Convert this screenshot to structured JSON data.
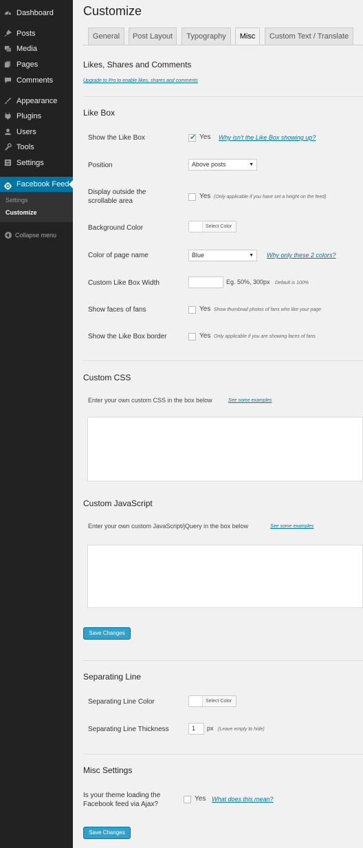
{
  "sidebar": {
    "items": [
      {
        "label": "Dashboard",
        "icon": "dashboard-icon"
      },
      {
        "label": "Posts",
        "icon": "pin-icon"
      },
      {
        "label": "Media",
        "icon": "media-icon"
      },
      {
        "label": "Pages",
        "icon": "pages-icon"
      },
      {
        "label": "Comments",
        "icon": "comments-icon"
      },
      {
        "label": "Appearance",
        "icon": "appearance-icon"
      },
      {
        "label": "Plugins",
        "icon": "plugins-icon"
      },
      {
        "label": "Users",
        "icon": "users-icon"
      },
      {
        "label": "Tools",
        "icon": "tools-icon"
      },
      {
        "label": "Settings",
        "icon": "settings-icon"
      }
    ],
    "active": {
      "label": "Facebook Feed",
      "icon": "facebook-feed-icon"
    },
    "submenu": [
      {
        "label": "Settings"
      },
      {
        "label": "Customize"
      }
    ],
    "collapse_label": "Collapse menu"
  },
  "page": {
    "title": "Customize",
    "tabs": [
      {
        "label": "General"
      },
      {
        "label": "Post Layout"
      },
      {
        "label": "Typography"
      },
      {
        "label": "Misc"
      },
      {
        "label": "Custom Text / Translate"
      }
    ],
    "active_tab": "Misc"
  },
  "likes": {
    "title": "Likes, Shares and Comments",
    "upgrade_link": "Upgrade to Pro to enable likes, shares and comments"
  },
  "likebox": {
    "title": "Like Box",
    "show_label": "Show the Like Box",
    "show_checked": true,
    "show_yes": "Yes",
    "show_help": "Why isn't the Like Box showing up?",
    "position_label": "Position",
    "position_value": "Above posts",
    "outside_label_1": "Display outside the",
    "outside_label_2": "scrollable area",
    "outside_yes": "Yes",
    "outside_note": "(Only applicable if you have set a height on the feed)",
    "bg_label": "Background Color",
    "bg_button": "Select Color",
    "pagename_label": "Color of page name",
    "pagename_value": "Blue",
    "pagename_help": "Why only these 2 colors?",
    "width_label": "Custom Like Box Width",
    "width_value": "",
    "width_hint": "Eg. 50%, 300px",
    "width_default": "Default is 100%",
    "faces_label": "Show faces of fans",
    "faces_yes": "Yes",
    "faces_note": "Show thumbnail photos of fans who like your page",
    "border_label": "Show the Like Box border",
    "border_yes": "Yes",
    "border_note": "Only applicable if you are showing faces of fans"
  },
  "css": {
    "title": "Custom CSS",
    "desc": "Enter your own custom CSS in the box below",
    "link": "See some examples"
  },
  "js": {
    "title": "Custom JavaScript",
    "desc": "Enter your own custom JavaScript/jQuery in the box below",
    "link": "See some examples"
  },
  "buttons": {
    "save": "Save Changes"
  },
  "sepline": {
    "title": "Separating Line",
    "color_label": "Separating Line Color",
    "color_button": "Select Color",
    "thickness_label": "Separating Line Thickness",
    "thickness_value": "1",
    "thickness_unit": "px",
    "thickness_note": "(Leave empty to hide)"
  },
  "misc": {
    "title": "Misc Settings",
    "ajax_label_1": "Is your theme loading the",
    "ajax_label_2": "Facebook feed via Ajax?",
    "ajax_yes": "Yes",
    "ajax_help": "What does this mean?"
  },
  "colors": {
    "sidebar_bg": "#222222",
    "active_menu": "#0074a2",
    "primary_button": "#2ea2cc",
    "link": "#0074a2"
  }
}
